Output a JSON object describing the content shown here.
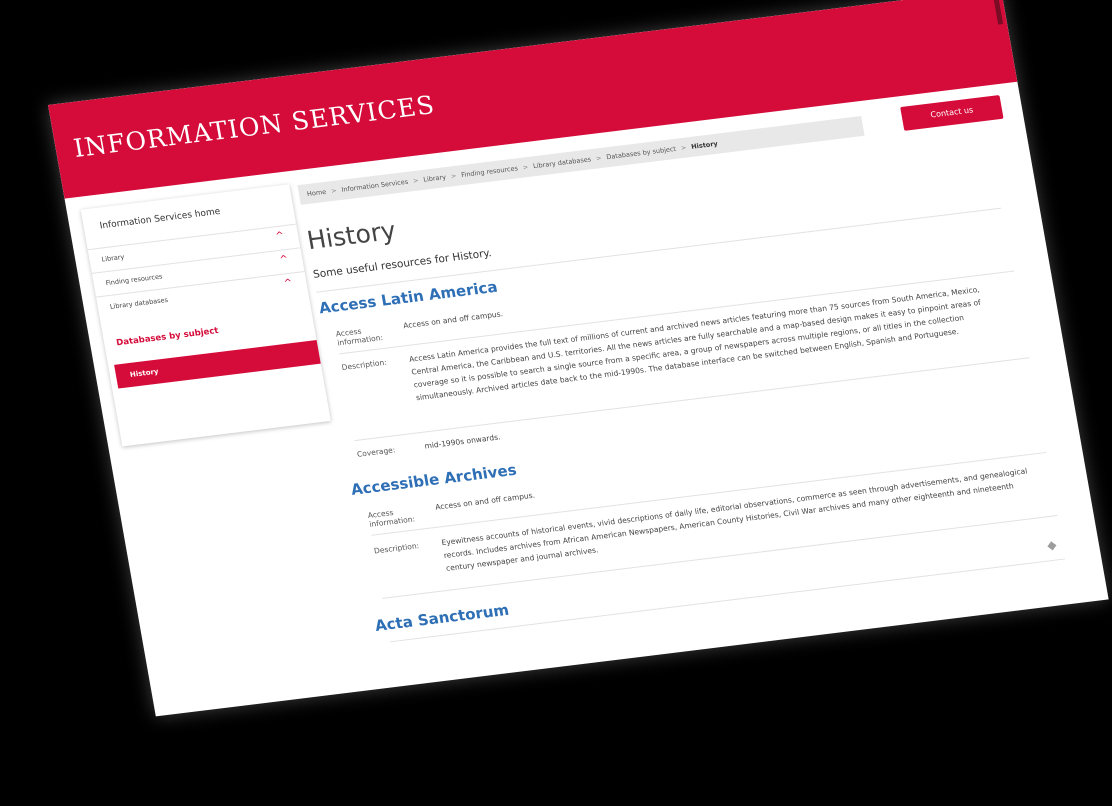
{
  "header": {
    "site_title": "INFORMATION SERVICES",
    "contact_label": "Contact us"
  },
  "breadcrumb": {
    "items": [
      "Home",
      "Information Services",
      "Library",
      "Finding resources",
      "Library databases",
      "Databases by subject",
      "History"
    ],
    "separator": ">"
  },
  "sidebar": {
    "home_label": "Information Services home",
    "items": [
      {
        "label": "Library"
      },
      {
        "label": "Finding resources"
      },
      {
        "label": "Library databases"
      }
    ],
    "subject_label": "Databases by subject",
    "active_label": "History",
    "expand_icon": "chevron-up-icon"
  },
  "main": {
    "title": "History",
    "intro": "Some useful resources for History.",
    "databases": [
      {
        "title": "Access Latin America",
        "access_label": "Access information:",
        "access": "Access on and off campus.",
        "description_label": "Description:",
        "description": "Access Latin America provides the full text of millions of current and archived news articles featuring more than 75 sources from South America, Mexico, Central America, the Caribbean and U.S. territories. All the news articles are fully searchable and a map-based design makes it easy to pinpoint areas of coverage so it is possible to search a single source from a specific area, a group of newspapers across multiple regions, or all titles in the collection simultaneously. Archived articles date back to the mid-1990s. The database interface can be switched between English, Spanish and Portuguese.",
        "coverage_label": "Coverage:",
        "coverage": "mid-1990s onwards."
      },
      {
        "title": "Accessible Archives",
        "access_label": "Access information:",
        "access": "Access on and off campus.",
        "description_label": "Description:",
        "description": "Eyewitness accounts of historical events, vivid descriptions of daily life, editorial observations, commerce as seen through advertisements, and genealogical records. Includes archives from African American Newspapers, American County Histories, Civil War archives and many other eighteenth and nineteenth century newspaper and journal archives."
      },
      {
        "title": "Acta Sanctorum"
      }
    ]
  },
  "colors": {
    "brand": "#d50c3a",
    "link": "#2e6fb5",
    "background": "#000000"
  },
  "icons": {
    "scroll_top": "diamond-arrow-icon"
  }
}
